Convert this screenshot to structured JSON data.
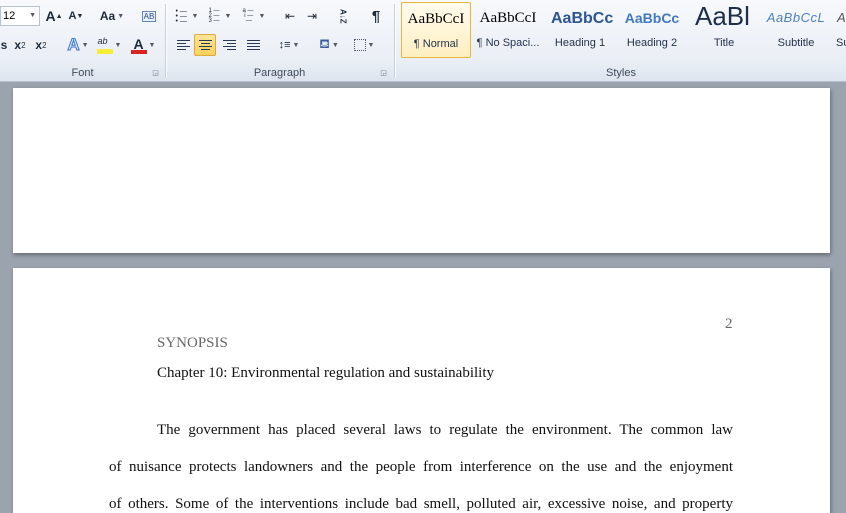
{
  "ribbon": {
    "font_group": {
      "label": "Font",
      "font_size": "12",
      "grow_font": "A",
      "shrink_font": "A",
      "change_case": "Aa",
      "subscript": "x",
      "superscript": "x",
      "text_effects": "A",
      "highlight": "ab",
      "font_color": "A",
      "clear_formatting": "AB"
    },
    "paragraph_group": {
      "label": "Paragraph",
      "pilcrow": "¶",
      "sort": "A↓Z"
    },
    "styles_group": {
      "label": "Styles",
      "tiles": [
        {
          "sample": "AaBbCcI",
          "name": "¶ Normal"
        },
        {
          "sample": "AaBbCcI",
          "name": "¶ No Spaci..."
        },
        {
          "sample": "AaBbCc",
          "name": "Heading 1"
        },
        {
          "sample": "AaBbCc",
          "name": "Heading 2"
        },
        {
          "sample": "AaBl",
          "name": "Title"
        },
        {
          "sample": "AaBbCcL",
          "name": "Subtitle"
        },
        {
          "sample": "A",
          "name": "Su"
        }
      ]
    },
    "colors": {
      "highlight_color": "#f6ee3a",
      "font_color_bar": "#d8231f",
      "accent_selected": "#ffd15c"
    }
  },
  "document": {
    "page_number": "2",
    "synopsis": "SYNOPSIS",
    "chapter": "Chapter 10: Environmental regulation and sustainability",
    "paragraph_lines": [
      "The government has placed several laws to regulate the environment. The common law",
      "of nuisance protects landowners and the people from interference on the use and the enjoyment",
      "of others. Some of the interventions include bad smell, polluted air, excessive noise, and property"
    ]
  }
}
